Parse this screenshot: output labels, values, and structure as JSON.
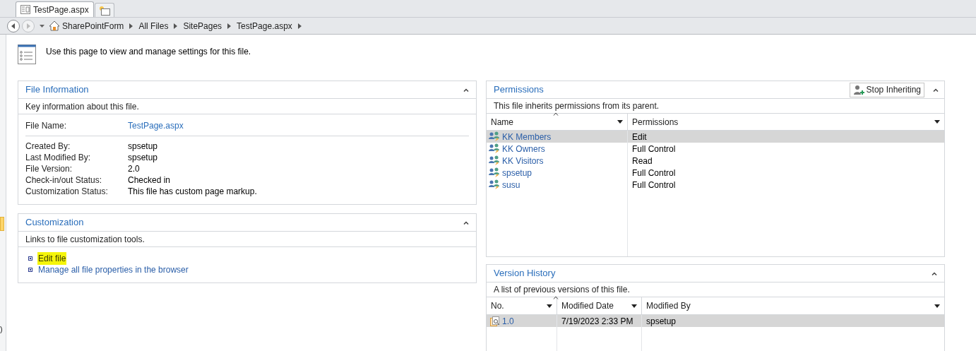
{
  "tabs": [
    {
      "label": "TestPage.aspx",
      "selected": true,
      "kind": "page"
    },
    {
      "selected": false,
      "kind": "new"
    }
  ],
  "breadcrumb": [
    "SharePointForm",
    "All Files",
    "SitePages",
    "TestPage.aspx"
  ],
  "left_edge": {
    "fragment": ")"
  },
  "intro": "Use this page to view and manage settings for this file.",
  "file_information": {
    "title": "File Information",
    "description": "Key information about this file.",
    "file_name": {
      "label": "File Name:",
      "value": "TestPage.aspx"
    },
    "fields": [
      {
        "label": "Created By:",
        "value": "spsetup"
      },
      {
        "label": "Last Modified By:",
        "value": "spsetup"
      },
      {
        "label": "File Version:",
        "value": "2.0"
      },
      {
        "label": "Check-in/out Status:",
        "value": "Checked in"
      },
      {
        "label": "Customization Status:",
        "value": "This file has custom page markup."
      }
    ]
  },
  "customization": {
    "title": "Customization",
    "description": "Links to file customization tools.",
    "links": [
      {
        "label": "Edit file",
        "highlighted": true
      },
      {
        "label": "Manage all file properties in the browser",
        "highlighted": false
      }
    ]
  },
  "permissions": {
    "title": "Permissions",
    "button": "Stop Inheriting",
    "description": "This file inherits permissions from its parent.",
    "columns": [
      "Name",
      "Permissions"
    ],
    "rows": [
      {
        "name": "KK Members",
        "permission": "Edit",
        "selected": true
      },
      {
        "name": "KK Owners",
        "permission": "Full Control",
        "selected": false
      },
      {
        "name": "KK Visitors",
        "permission": "Read",
        "selected": false
      },
      {
        "name": "spsetup",
        "permission": "Full Control",
        "selected": false
      },
      {
        "name": "susu",
        "permission": "Full Control",
        "selected": false
      }
    ]
  },
  "version_history": {
    "title": "Version History",
    "description": "A list of previous versions of this file.",
    "columns": [
      "No.",
      "Modified Date",
      "Modified By"
    ],
    "rows": [
      {
        "number": "1.0",
        "modified_date": "7/19/2023 2:33 PM",
        "modified_by": "spsetup",
        "selected": true
      }
    ]
  }
}
